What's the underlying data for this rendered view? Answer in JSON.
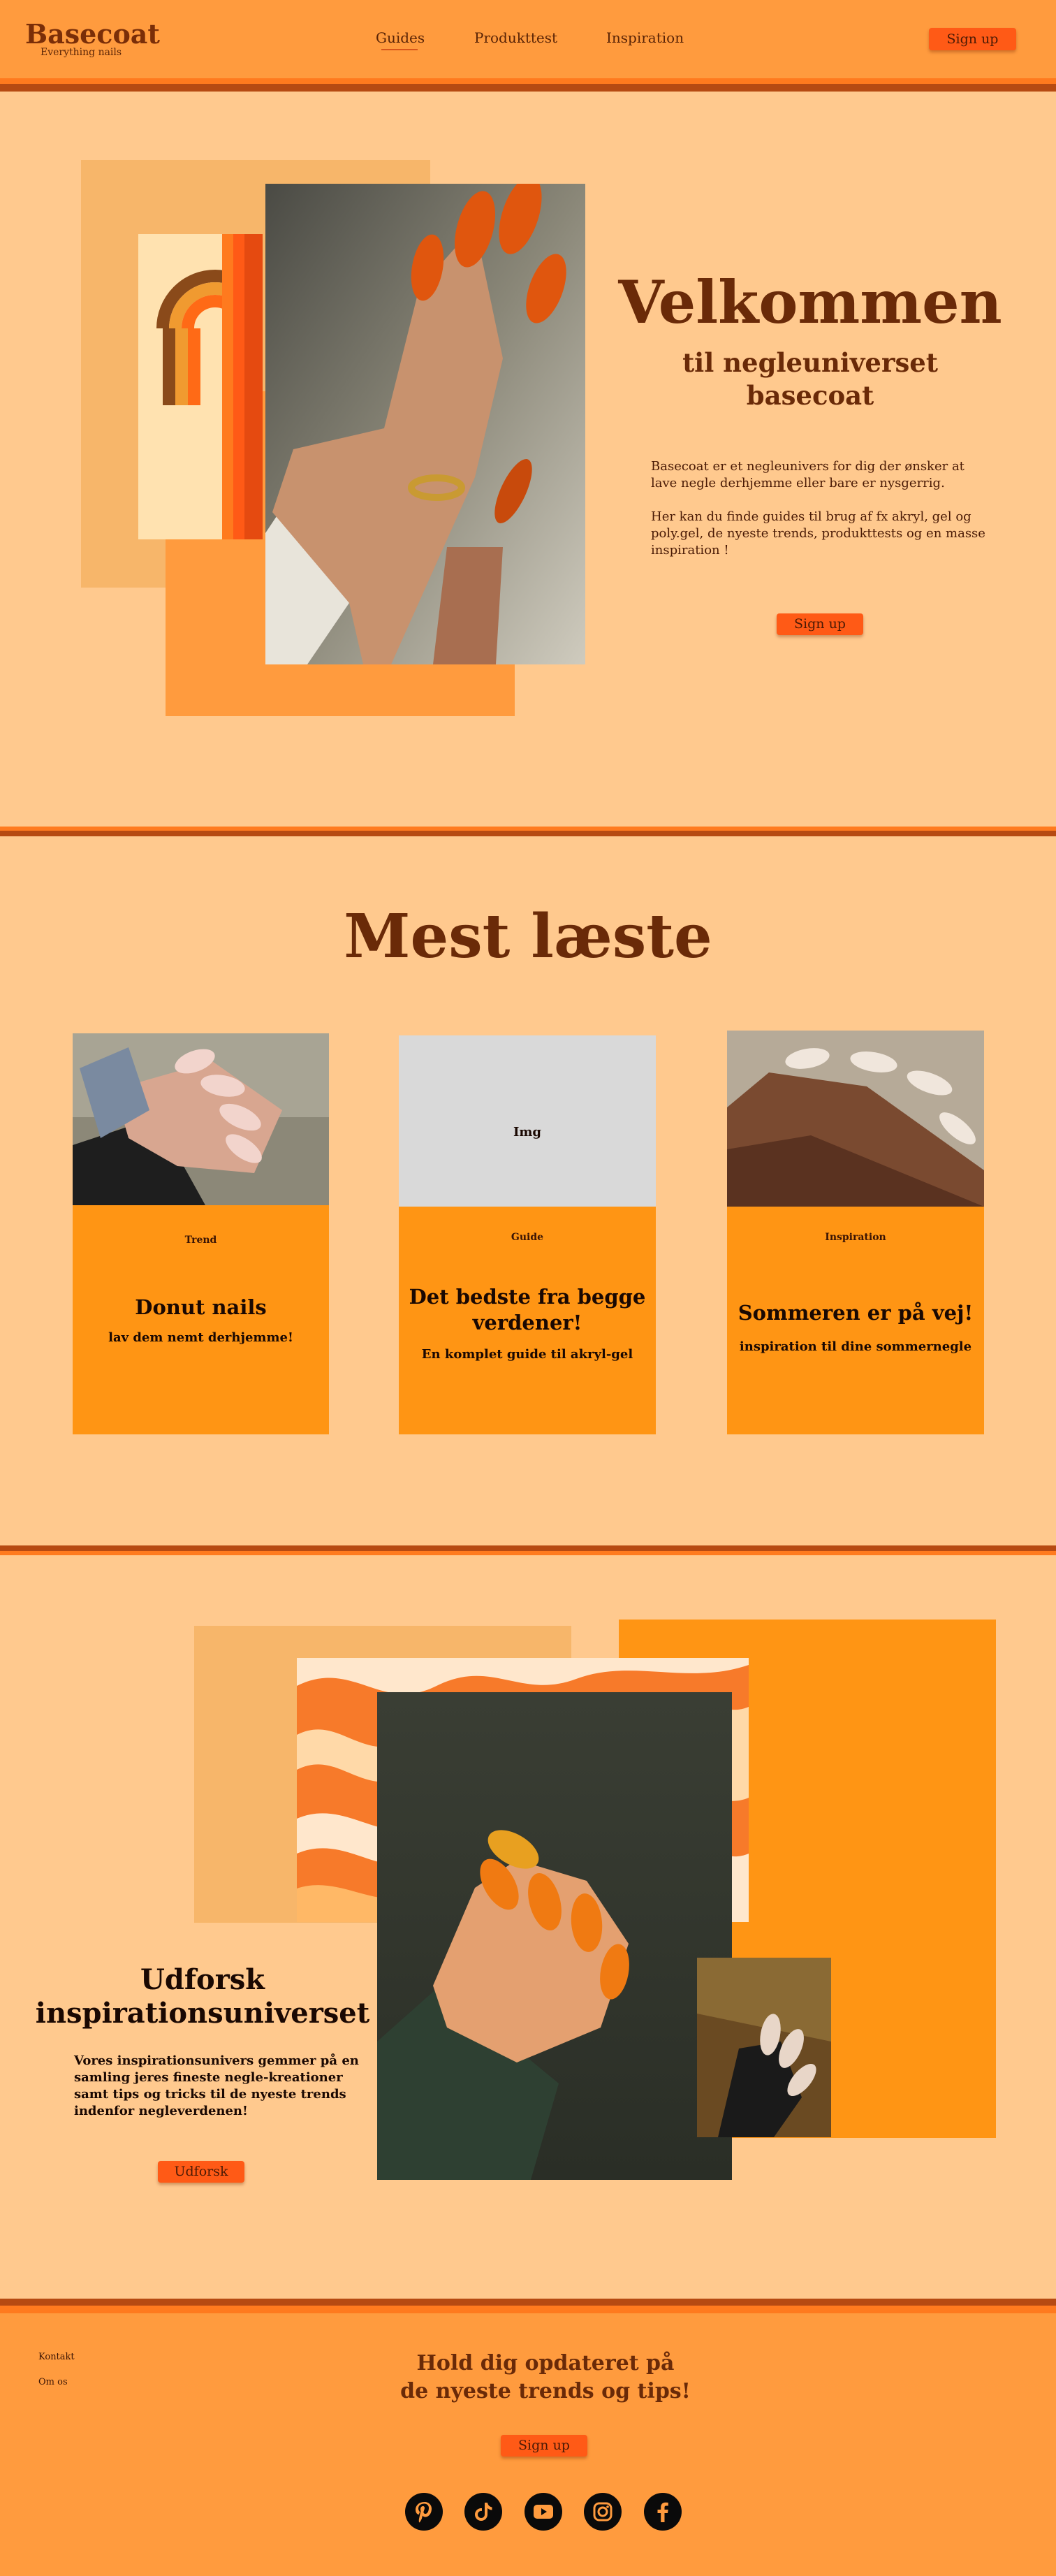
{
  "header": {
    "logo_title": "Basecoat",
    "logo_subtitle": "Everything nails",
    "nav": [
      "Guides",
      "Produkttest",
      "Inspiration"
    ],
    "signup_label": "Sign up"
  },
  "hero": {
    "title": "Velkommen",
    "subtitle_line1": "til negleuniverset",
    "subtitle_line2": "basecoat",
    "paragraph1": "Basecoat er et negleunivers for dig der ønsker at lave negle derhjemme eller bare er nysgerrig.",
    "paragraph2": "Her kan du finde guides til brug af fx akryl, gel og poly.gel, de nyeste trends, produkttests og en masse inspiration !",
    "signup_label": "Sign up"
  },
  "most_read": {
    "title": "Mest læste",
    "cards": [
      {
        "label": "Trend",
        "title": "Donut nails",
        "desc": "lav dem nemt derhjemme!"
      },
      {
        "label": "Guide",
        "image_placeholder": "Img",
        "title_line1": "Det bedste fra begge",
        "title_line2": "verdener!",
        "desc": "En komplet guide til akryl-gel"
      },
      {
        "label": "Inspiration",
        "title": "Sommeren er på vej!",
        "desc": "inspiration til dine sommernegle"
      }
    ]
  },
  "explore": {
    "title_line1": "Udforsk",
    "title_line2": "inspirationsuniverset",
    "paragraph": "Vores inspirationsunivers gemmer på en samling jeres fineste negle-kreationer samt tips og tricks til de nyeste trends indenfor negleverdenen!",
    "button_label": "Udforsk"
  },
  "footer": {
    "links": [
      "Kontakt",
      "Om os"
    ],
    "title_line1": "Hold dig opdateret på",
    "title_line2": "de nyeste trends og tips!",
    "signup_label": "Sign up",
    "social_icons": [
      "pinterest-icon",
      "tiktok-icon",
      "youtube-icon",
      "instagram-icon",
      "facebook-icon"
    ]
  },
  "colors": {
    "page_bg": "#FFC98E",
    "header_bg": "#FF9B3E",
    "accent_orange": "#FF9514",
    "button": "#FF5A16",
    "heading_brown": "#6A2A08"
  }
}
